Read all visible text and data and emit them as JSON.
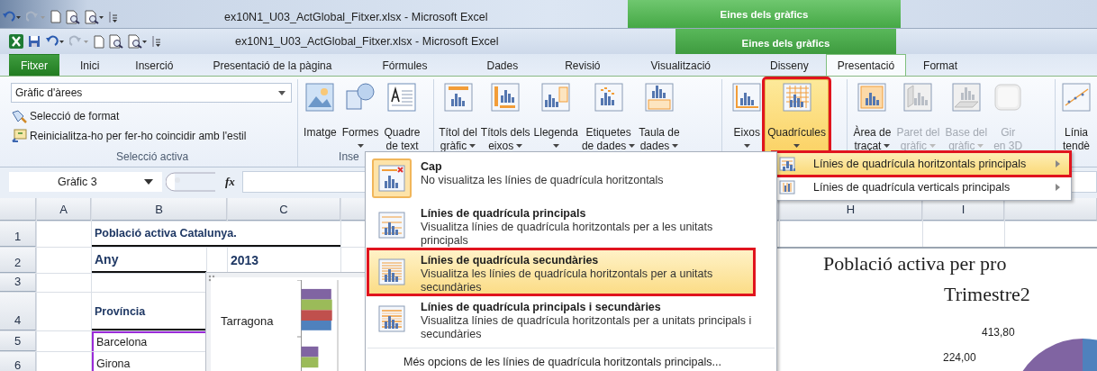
{
  "back_window": {
    "title": "ex10N1_U03_ActGlobal_Fitxer.xlsx - Microsoft Excel",
    "context_label": "Eines dels gràfics"
  },
  "window": {
    "title": "ex10N1_U03_ActGlobal_Fitxer.xlsx - Microsoft Excel",
    "context_label": "Eines dels gràfics"
  },
  "tabs": [
    {
      "label": "Fitxer",
      "kind": "file",
      "selected": false
    },
    {
      "label": "Inici",
      "kind": "normal",
      "selected": false
    },
    {
      "label": "Inserció",
      "kind": "normal",
      "selected": false
    },
    {
      "label": "Presentació de la pàgina",
      "kind": "normal",
      "selected": false
    },
    {
      "label": "Fórmules",
      "kind": "normal",
      "selected": false
    },
    {
      "label": "Dades",
      "kind": "normal",
      "selected": false
    },
    {
      "label": "Revisió",
      "kind": "normal",
      "selected": false
    },
    {
      "label": "Visualització",
      "kind": "normal",
      "selected": false
    },
    {
      "label": "Disseny",
      "kind": "context",
      "selected": false
    },
    {
      "label": "Presentació",
      "kind": "context",
      "selected": true
    },
    {
      "label": "Format",
      "kind": "context",
      "selected": false
    }
  ],
  "ribbon": {
    "selection_group": {
      "label": "Selecció activa",
      "dropdown_value": "Gràfic d'àrees",
      "commands": [
        {
          "label": "Selecció de format"
        },
        {
          "label": "Reinicialitza-ho per fer-ho coincidir amb l'estil"
        }
      ]
    },
    "groups": [
      {
        "label": "Inse",
        "buttons": [
          {
            "lines": [
              "Imatge"
            ],
            "caret": false,
            "disabled": false,
            "selected": false,
            "outlined": false
          },
          {
            "lines": [
              "Formes"
            ],
            "caret": true,
            "disabled": false,
            "selected": false,
            "outlined": false
          },
          {
            "lines": [
              "Quadre",
              "de text"
            ],
            "caret": false,
            "disabled": false,
            "selected": false,
            "outlined": false
          }
        ]
      },
      {
        "buttons": [
          {
            "lines": [
              "Títol del",
              "gràfic"
            ],
            "caret": true,
            "disabled": false,
            "selected": false,
            "outlined": false
          },
          {
            "lines": [
              "Títols dels",
              "eixos"
            ],
            "caret": true,
            "disabled": false,
            "selected": false,
            "outlined": false
          },
          {
            "lines": [
              "Llegenda"
            ],
            "caret": true,
            "disabled": false,
            "selected": false,
            "outlined": false
          },
          {
            "lines": [
              "Etiquetes",
              "de dades"
            ],
            "caret": true,
            "disabled": false,
            "selected": false,
            "outlined": false
          },
          {
            "lines": [
              "Taula de",
              "dades"
            ],
            "caret": true,
            "disabled": false,
            "selected": false,
            "outlined": false
          }
        ]
      },
      {
        "buttons": [
          {
            "lines": [
              "Eixos"
            ],
            "caret": true,
            "disabled": false,
            "selected": false,
            "outlined": false
          },
          {
            "lines": [
              "Quadrícules"
            ],
            "caret": true,
            "disabled": false,
            "selected": true,
            "outlined": true
          }
        ]
      },
      {
        "buttons": [
          {
            "lines": [
              "Àrea de",
              "traçat"
            ],
            "caret": true,
            "disabled": false,
            "selected": false,
            "outlined": false
          },
          {
            "lines": [
              "Paret del",
              "gràfic"
            ],
            "caret": true,
            "disabled": true,
            "selected": false,
            "outlined": false
          },
          {
            "lines": [
              "Base del",
              "gràfic"
            ],
            "caret": true,
            "disabled": true,
            "selected": false,
            "outlined": false
          },
          {
            "lines": [
              "Gir",
              "en 3D"
            ],
            "caret": false,
            "disabled": true,
            "selected": false,
            "outlined": false
          }
        ]
      },
      {
        "buttons": [
          {
            "lines": [
              "Línia",
              "tendè"
            ],
            "caret": false,
            "disabled": false,
            "selected": false,
            "outlined": false
          }
        ]
      }
    ]
  },
  "formula_bar": {
    "name_box": "Gràfic 3",
    "function_label": "fx"
  },
  "sheet": {
    "columns": [
      {
        "label": "A"
      },
      {
        "label": "B"
      },
      {
        "label": "C"
      },
      {
        "label": "H"
      },
      {
        "label": "I"
      }
    ],
    "rows": [
      {
        "label": "1",
        "kind": "title",
        "cells": {
          "B": "Població activa Catalunya."
        },
        "in_range": false
      },
      {
        "label": "2",
        "kind": "heading",
        "cells": {
          "B": "Any",
          "C": "2013"
        },
        "in_range": false
      },
      {
        "label": "3",
        "kind": "data",
        "cells": {},
        "in_range": false
      },
      {
        "label": "4",
        "kind": "subheading",
        "cells": {
          "B": "Província"
        },
        "in_range": false
      },
      {
        "label": "5",
        "kind": "data",
        "cells": {
          "B": "Barcelona"
        },
        "in_range": true
      },
      {
        "label": "6",
        "kind": "data",
        "cells": {
          "B": "Girona"
        },
        "in_range": true
      }
    ]
  },
  "bar_chart": {
    "category_label": "Tarragona"
  },
  "pie_chart": {
    "title_lines": [
      "Població activa per pro",
      "Trimestre2"
    ],
    "data_labels": [
      "413,80",
      "224,00"
    ]
  },
  "gridlines_menu": {
    "items": [
      {
        "label": "Línies de quadrícula horitzontals principals",
        "highlighted": true,
        "outlined": true
      },
      {
        "label": "Línies de quadrícula verticals principals",
        "highlighted": false,
        "outlined": false
      }
    ]
  },
  "horizontal_submenu": {
    "items": [
      {
        "title": "Cap",
        "description": "No visualitza les línies de quadrícula horitzontals",
        "selected": true,
        "highlighted": false,
        "outlined": false
      },
      {
        "title": "Línies de quadrícula principals",
        "description": "Visualitza línies de quadrícula horitzontals per a les unitats principals",
        "selected": false,
        "highlighted": false,
        "outlined": false
      },
      {
        "title": "Línies de quadrícula secundàries",
        "description": "Visualitza les línies de quadrícula horitzontals per a unitats secundàries",
        "selected": false,
        "highlighted": true,
        "outlined": true
      },
      {
        "title": "Línies de quadrícula principals i secundàries",
        "description": "Visualitza línies de quadrícula horitzontals per a unitats principals i secundàries",
        "selected": false,
        "highlighted": false,
        "outlined": false
      }
    ],
    "footer": "Més opcions de les línies de quadrícula horitzontals principals..."
  }
}
